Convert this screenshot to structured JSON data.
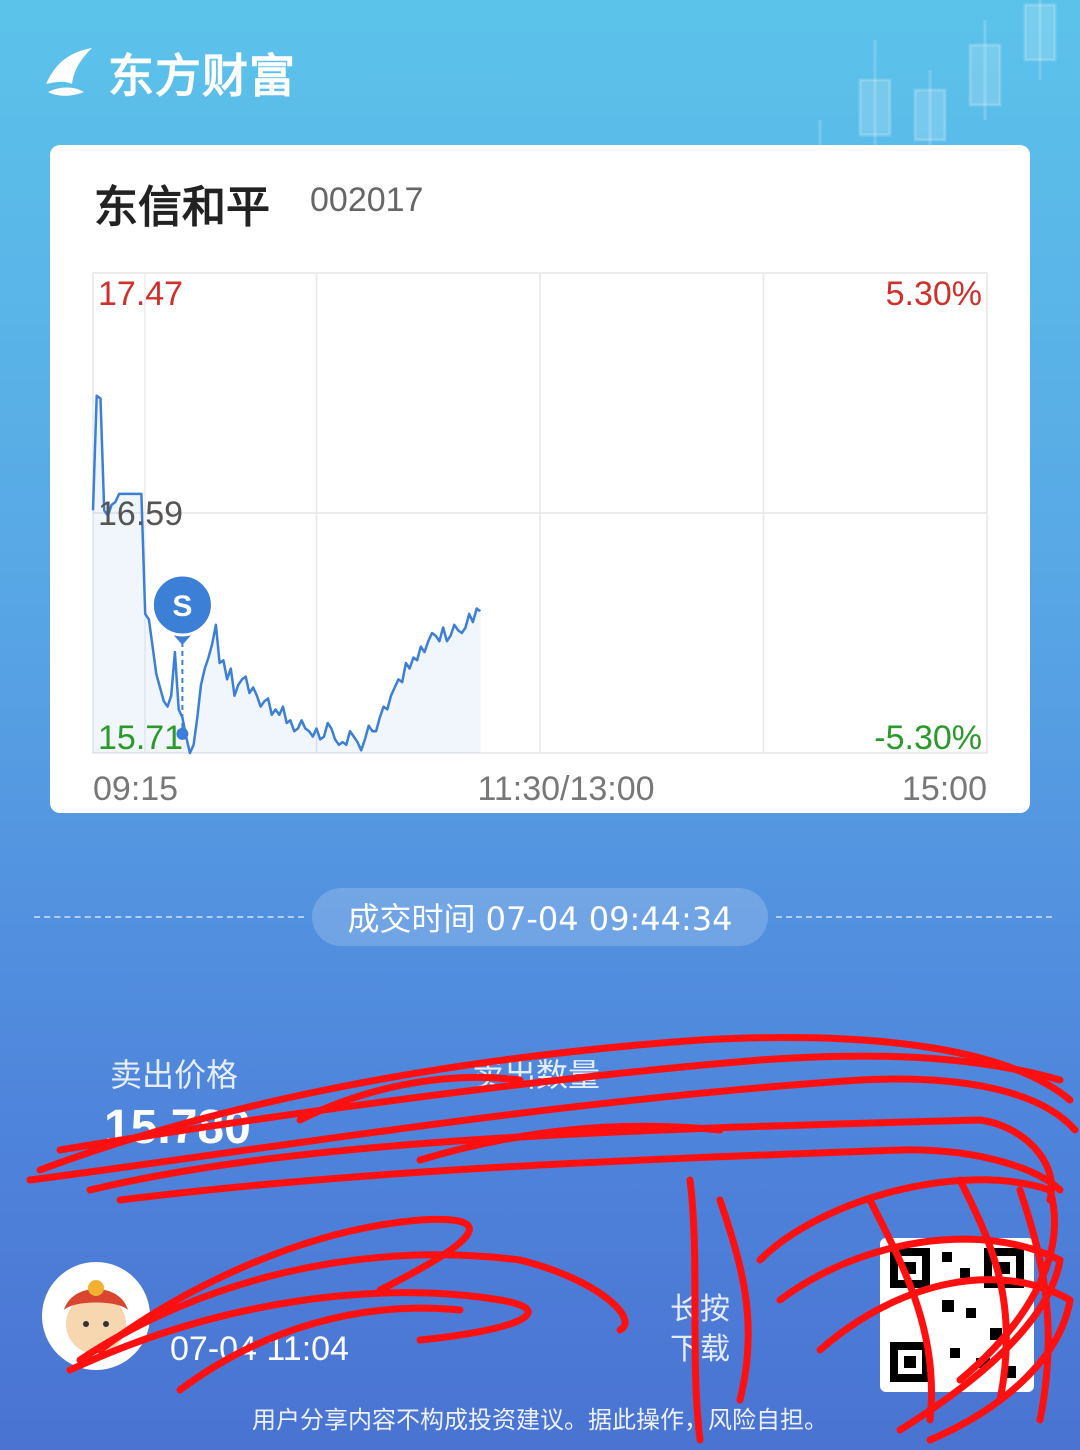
{
  "brand": {
    "name": "东方财富"
  },
  "stock": {
    "name": "东信和平",
    "code": "002017"
  },
  "chart_data": {
    "type": "line",
    "y_labels": {
      "top": "17.47",
      "middle": "16.59",
      "bottom": "15.71"
    },
    "pct_labels": {
      "top": "5.30%",
      "bottom": "-5.30%"
    },
    "x_labels": {
      "start": "09:15",
      "middle": "11:30/13:00",
      "end": "15:00"
    },
    "ylim": [
      15.71,
      17.47
    ],
    "prev_close": 16.59,
    "x_range_minutes": [
      0,
      240
    ],
    "series": [
      {
        "x": [
          0,
          1,
          2,
          3,
          4,
          5,
          6,
          7,
          8,
          9,
          10,
          11,
          12,
          13,
          14,
          15,
          16,
          17,
          18,
          19,
          20,
          21,
          22,
          23,
          24,
          25,
          26,
          27,
          28,
          29,
          30,
          31,
          32,
          33,
          34,
          35,
          36,
          37,
          38,
          39,
          40,
          41,
          42,
          43,
          44,
          45,
          46,
          47,
          48,
          49,
          50,
          51,
          52,
          53,
          54,
          55,
          56,
          57,
          58,
          59,
          60,
          61,
          62,
          63,
          64,
          65,
          66,
          67,
          68,
          69,
          70,
          71,
          72,
          73,
          74,
          75,
          76,
          77,
          78,
          79,
          80,
          81,
          82,
          83,
          84,
          85,
          86,
          87,
          88,
          89,
          90,
          91,
          92,
          93,
          94,
          95,
          96,
          97,
          98,
          99,
          100,
          101,
          102,
          103,
          104
        ],
        "values": [
          16.6,
          17.02,
          17.01,
          16.6,
          16.58,
          16.62,
          16.63,
          16.66,
          16.66,
          16.66,
          16.66,
          16.66,
          16.66,
          16.66,
          16.22,
          16.2,
          16.1,
          16.0,
          15.95,
          15.9,
          15.88,
          15.92,
          16.08,
          15.87,
          15.84,
          15.77,
          15.71,
          15.74,
          15.84,
          15.96,
          16.02,
          16.06,
          16.11,
          16.18,
          16.04,
          16.05,
          15.98,
          16.02,
          15.92,
          15.96,
          15.98,
          15.99,
          15.93,
          15.95,
          15.92,
          15.88,
          15.9,
          15.91,
          15.85,
          15.87,
          15.85,
          15.88,
          15.82,
          15.83,
          15.79,
          15.8,
          15.83,
          15.8,
          15.79,
          15.77,
          15.8,
          15.76,
          15.77,
          15.82,
          15.8,
          15.76,
          15.74,
          15.75,
          15.74,
          15.79,
          15.77,
          15.75,
          15.72,
          15.76,
          15.81,
          15.79,
          15.79,
          15.84,
          15.88,
          15.87,
          15.92,
          15.95,
          15.98,
          15.97,
          16.04,
          16.02,
          16.06,
          16.05,
          16.1,
          16.08,
          16.12,
          16.15,
          16.14,
          16.12,
          16.17,
          16.12,
          16.14,
          16.18,
          16.16,
          16.15,
          16.17,
          16.22,
          16.19,
          16.24,
          16.23
        ]
      }
    ],
    "trade_marker": {
      "label": "S",
      "x": 24,
      "value": 15.78
    },
    "grid": true
  },
  "trade": {
    "time_text": "成交时间 07-04 09:44:34",
    "sell_price_label": "卖出价格",
    "sell_price_value": "15.780",
    "sell_qty_label": "卖出数量"
  },
  "footer": {
    "share_time": "07-04 11:04",
    "promo_line1": "长按",
    "promo_line2": "下载",
    "disclaimer": "用户分享内容不构成投资建议。据此操作，风险自担。"
  },
  "colors": {
    "up": "#d0302c",
    "down": "#2a9a2a",
    "line": "#3b7fd6",
    "marker": "#3b7fd6",
    "scribble": "#ff1010"
  }
}
